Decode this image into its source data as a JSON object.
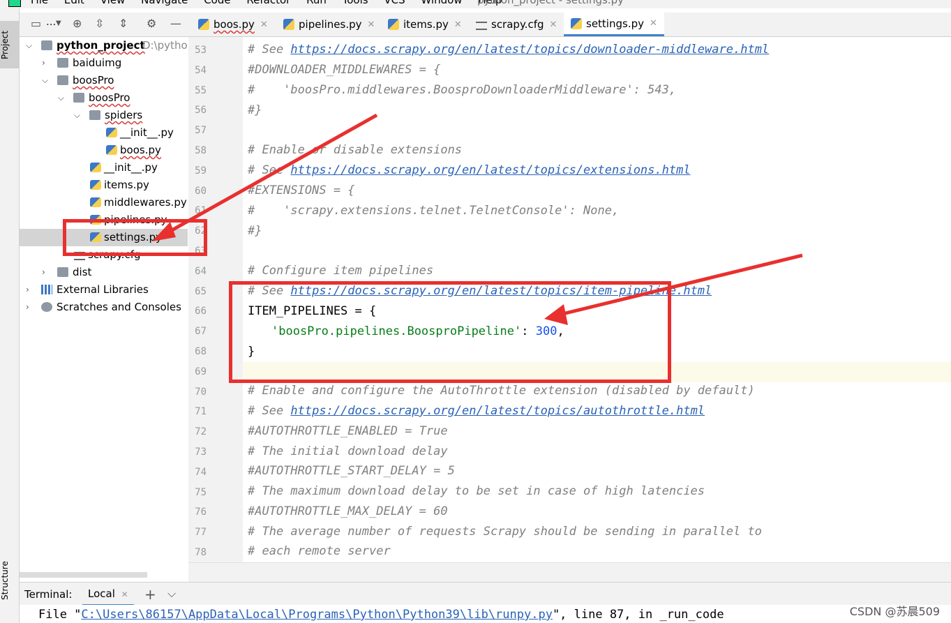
{
  "menubar": {
    "items": [
      "File",
      "Edit",
      "View",
      "Navigate",
      "Code",
      "Refactor",
      "Run",
      "Tools",
      "VCS",
      "Window",
      "Help"
    ],
    "window_title": "python_project - settings.py"
  },
  "toolstrip": {
    "project_label": "Project",
    "structure_label": "Structure"
  },
  "toolbar": {
    "project_selector": "...",
    "tabs": [
      {
        "label": "boos.py",
        "icon": "python-file-icon"
      },
      {
        "label": "pipelines.py",
        "icon": "python-file-icon"
      },
      {
        "label": "items.py",
        "icon": "python-file-icon"
      },
      {
        "label": "scrapy.cfg",
        "icon": "config-file-icon"
      },
      {
        "label": "settings.py",
        "icon": "python-file-icon",
        "active": true
      }
    ]
  },
  "tree": {
    "root": {
      "label": "python_project",
      "path": "D:\\pytho"
    },
    "items": [
      {
        "label": "baiduimg"
      },
      {
        "label": "boosPro"
      },
      {
        "label": "boosPro"
      },
      {
        "label": "spiders"
      },
      {
        "label": "__init__.py"
      },
      {
        "label": "boos.py"
      },
      {
        "label": "__init__.py"
      },
      {
        "label": "items.py"
      },
      {
        "label": "middlewares.py"
      },
      {
        "label": "pipelines.py"
      },
      {
        "label": "settings.py"
      },
      {
        "label": "scrapy.cfg"
      },
      {
        "label": "dist"
      },
      {
        "label": "External Libraries"
      },
      {
        "label": "Scratches and Consoles"
      }
    ]
  },
  "editor": {
    "line_numbers": [
      "53",
      "54",
      "55",
      "56",
      "57",
      "58",
      "59",
      "60",
      "61",
      "62",
      "63",
      "64",
      "65",
      "66",
      "67",
      "68",
      "69",
      "70",
      "71",
      "72",
      "73",
      "74",
      "75",
      "76",
      "77",
      "78"
    ],
    "lines": {
      "l53a": "# See ",
      "l53u": "https://docs.scrapy.org/en/latest/topics/downloader-middleware.html",
      "l54": "#DOWNLOADER_MIDDLEWARES = {",
      "l55": "#    'boosPro.middlewares.BoosproDownloaderMiddleware': 543,",
      "l56": "#}",
      "l58": "# Enable or disable extensions",
      "l59a": "# See ",
      "l59u": "https://docs.scrapy.org/en/latest/topics/extensions.html",
      "l60": "#EXTENSIONS = {",
      "l61": "#    'scrapy.extensions.telnet.TelnetConsole': None,",
      "l62": "#}",
      "l64": "# Configure item pipelines",
      "l65a": "# See ",
      "l65u": "https://docs.scrapy.org/en/latest/topics/item-pipeline.html",
      "l66": "ITEM_PIPELINES = {",
      "l67s": "'boosPro.pipelines.BoosproPipeline'",
      "l67c": ": ",
      "l67n": "300",
      "l67e": ",",
      "l68": "}",
      "l70": "# Enable and configure the AutoThrottle extension (disabled by default)",
      "l71a": "# See ",
      "l71u": "https://docs.scrapy.org/en/latest/topics/autothrottle.html",
      "l72": "#AUTOTHROTTLE_ENABLED = True",
      "l73": "# The initial download delay",
      "l74": "#AUTOTHROTTLE_START_DELAY = 5",
      "l75": "# The maximum download delay to be set in case of high latencies",
      "l76": "#AUTOTHROTTLE_MAX_DELAY = 60",
      "l77": "# The average number of requests Scrapy should be sending in parallel to",
      "l78": "# each remote server"
    }
  },
  "terminal": {
    "title": "Terminal:",
    "tab": "Local",
    "plus": "+",
    "line_prefix": "File \"",
    "line_path": "C:\\Users\\86157\\AppData\\Local\\Programs\\Python\\Python39\\lib\\runpy.py",
    "line_suffix": "\", line 87, in _run_code"
  },
  "watermark": "CSDN @苏晨509",
  "colors": {
    "annotation_red": "#e8302f",
    "accent_blue": "#4083c9"
  }
}
